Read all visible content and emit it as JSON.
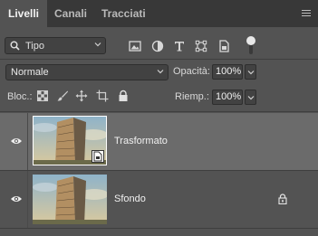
{
  "tabs": [
    "Livelli",
    "Canali",
    "Tracciati"
  ],
  "filter": {
    "label": "Tipo",
    "icons": [
      "image-filter-icon",
      "adjustment-filter-icon",
      "type-filter-icon",
      "shape-filter-icon",
      "smart-object-filter-icon"
    ]
  },
  "blend": {
    "mode": "Normale",
    "opacity_label": "Opacità:",
    "opacity_value": "100%"
  },
  "lock": {
    "label": "Bloc.:",
    "icons": [
      "lock-transparent-icon",
      "lock-image-icon",
      "lock-position-icon",
      "lock-artboard-icon",
      "lock-all-icon"
    ],
    "fill_label": "Riemp.:",
    "fill_value": "100%"
  },
  "layers": [
    {
      "name": "Trasformato",
      "selected": true,
      "visible": true,
      "smart_object": true,
      "locked": false
    },
    {
      "name": "Sfondo",
      "selected": false,
      "visible": true,
      "smart_object": false,
      "locked": true
    }
  ],
  "colors": {
    "panel": "#535353",
    "tabbar": "#383838",
    "selected_layer": "#6b6b6b"
  }
}
